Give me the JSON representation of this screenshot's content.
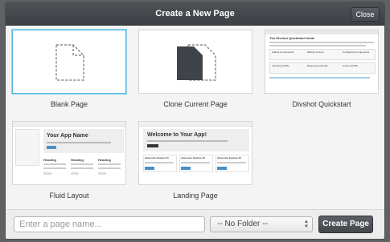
{
  "dialog": {
    "title": "Create a New Page",
    "close_label": "Close"
  },
  "templates": [
    {
      "label": "Blank Page"
    },
    {
      "label": "Clone Current Page"
    },
    {
      "label": "Divshot Quickstart"
    },
    {
      "label": "Fluid Layout"
    },
    {
      "label": "Landing Page"
    }
  ],
  "previews": {
    "quickstart": {
      "heading": "The Divshot Quickstart Guide",
      "sections": [
        "Adding Components",
        "Editing Content",
        "Configuring Components",
        "Importing HTML",
        "Responsive Design",
        "Custom HTML"
      ]
    },
    "fluid": {
      "app_name": "Your App Name",
      "columns": [
        "Heading",
        "Heading",
        "Heading"
      ]
    },
    "landing": {
      "heading": "Welcome to Your App!",
      "features": [
        "Awesome Feature #1",
        "Awesome Feature #2",
        "Awesome Feature #3"
      ]
    }
  },
  "footer": {
    "name_placeholder": "Enter a page name...",
    "folder_selected": "-- No Folder --",
    "create_label": "Create Page"
  },
  "colors": {
    "accent": "#55b7e0",
    "titlebar": "#45484d",
    "doc_icon_dark": "#3f444a"
  }
}
